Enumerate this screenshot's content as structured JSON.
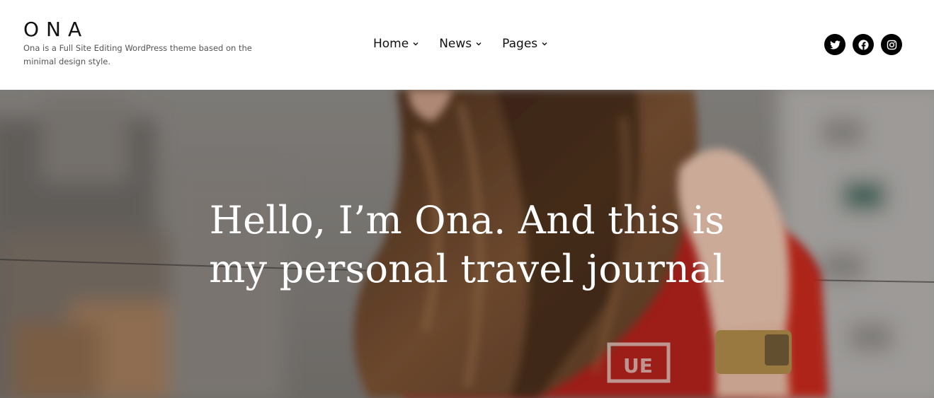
{
  "header": {
    "site_title": "ONA",
    "tagline": "Ona is a Full Site Editing WordPress theme based on the minimal design style.",
    "nav": [
      {
        "label": "Home"
      },
      {
        "label": "News"
      },
      {
        "label": "Pages"
      }
    ],
    "social": [
      {
        "icon": "twitter-icon"
      },
      {
        "icon": "facebook-icon"
      },
      {
        "icon": "instagram-icon"
      }
    ]
  },
  "hero": {
    "heading_line1": "Hello, I’m Ona. And this is",
    "heading_line2": "my personal travel journal"
  },
  "colors": {
    "text": "#111111",
    "tagline": "#555555",
    "icon_bg": "#000000",
    "hero_text": "#ffffff"
  }
}
